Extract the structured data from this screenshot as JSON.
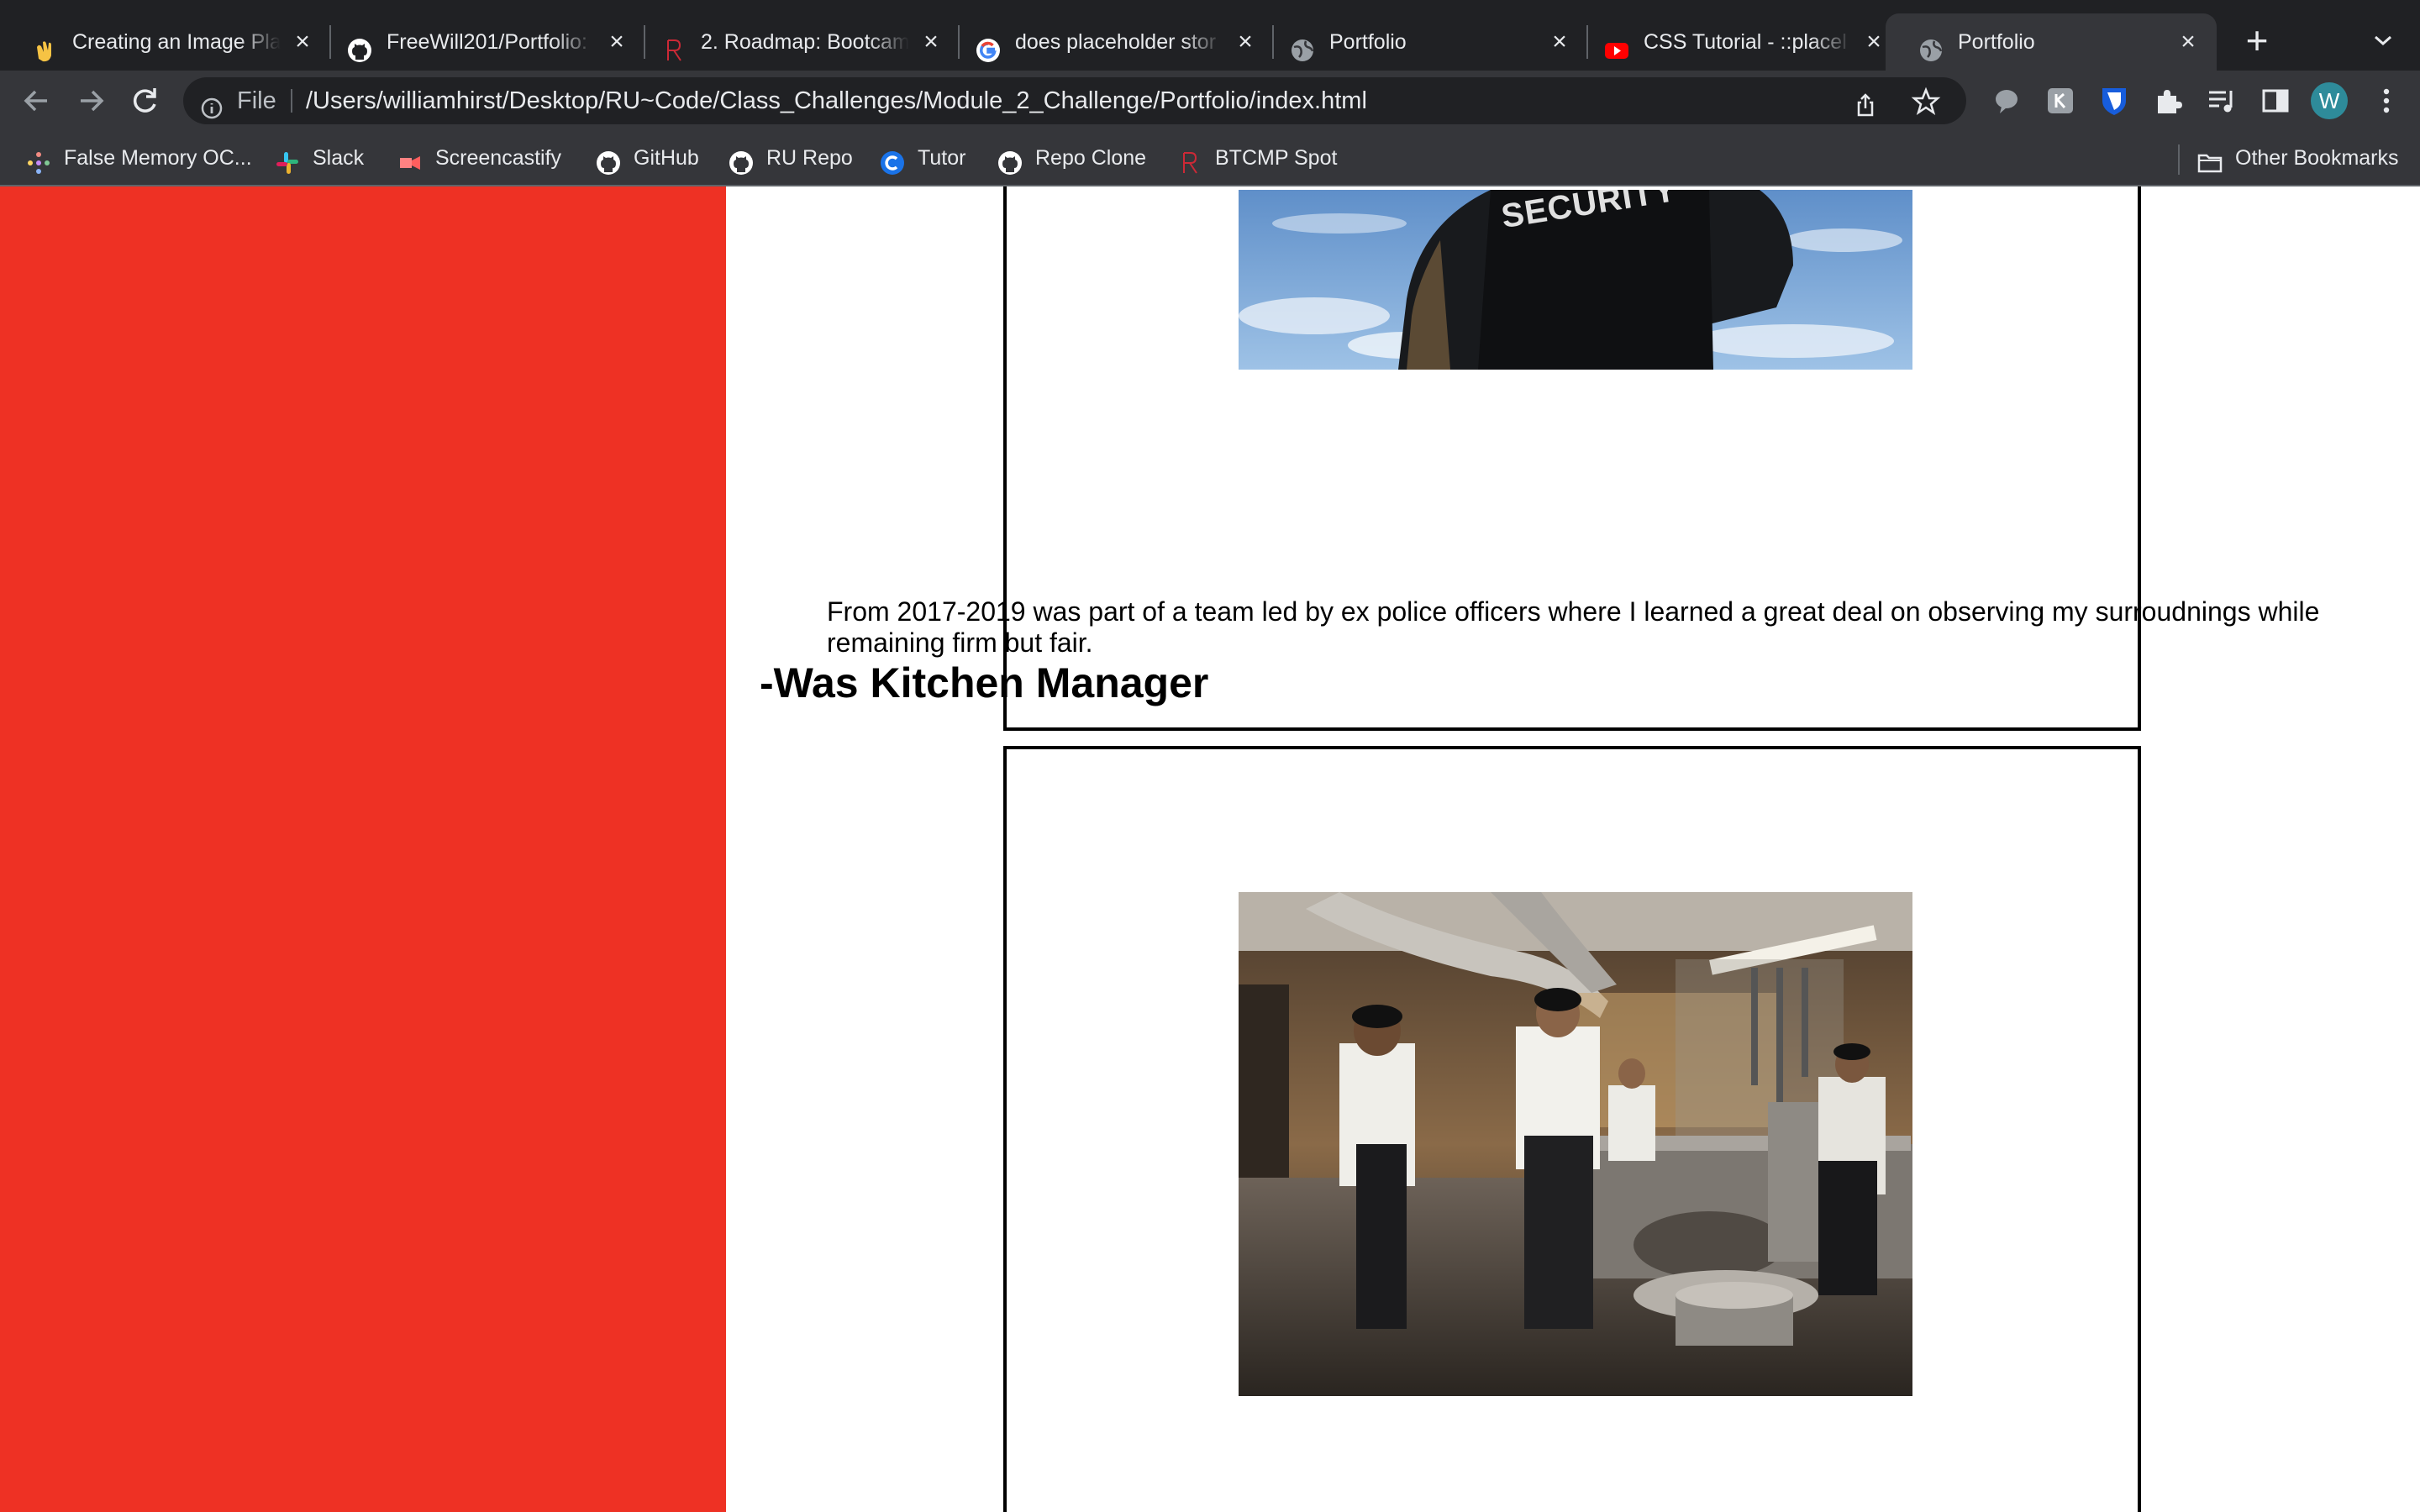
{
  "browser": {
    "tabs": [
      {
        "title": "Creating an Image Pla",
        "icon": "clapping-hands-icon"
      },
      {
        "title": "FreeWill201/Portfolio:",
        "icon": "github-icon"
      },
      {
        "title": "2. Roadmap: Bootcam",
        "icon": "rutgers-r-icon"
      },
      {
        "title": "does placeholder stor",
        "icon": "google-icon"
      },
      {
        "title": "Portfolio",
        "icon": "globe-icon"
      },
      {
        "title": "CSS Tutorial - ::placel",
        "icon": "youtube-icon"
      },
      {
        "title": "Portfolio",
        "icon": "globe-icon",
        "active": true
      }
    ],
    "address_bar": {
      "scheme_label": "File",
      "url": "/Users/williamhirst/Desktop/RU~Code/Class_Challenges/Module_2_Challenge/Portfolio/index.html"
    },
    "profile_initial": "W",
    "bookmarks": [
      {
        "label": "False Memory OC...",
        "icon": "dots-icon"
      },
      {
        "label": "Slack",
        "icon": "slack-icon"
      },
      {
        "label": "Screencastify",
        "icon": "screencastify-icon"
      },
      {
        "label": "GitHub",
        "icon": "github-icon"
      },
      {
        "label": "RU Repo",
        "icon": "github-icon"
      },
      {
        "label": "Tutor",
        "icon": "tutor-icon"
      },
      {
        "label": "Repo Clone",
        "icon": "github-icon"
      },
      {
        "label": "BTCMP Spot",
        "icon": "rutgers-r-icon"
      }
    ],
    "other_bookmarks": "Other Bookmarks"
  },
  "page": {
    "colors": {
      "sidebar": "#ee3124",
      "text": "#000000"
    },
    "security_photo_text": "SECURITY",
    "security_description": "From 2017-2019 was part of a team led by ex police officers where I learned a great deal on observing my surroudnings while remaining firm but fair.",
    "kitchen_heading": "-Was Kitchen Manager"
  }
}
